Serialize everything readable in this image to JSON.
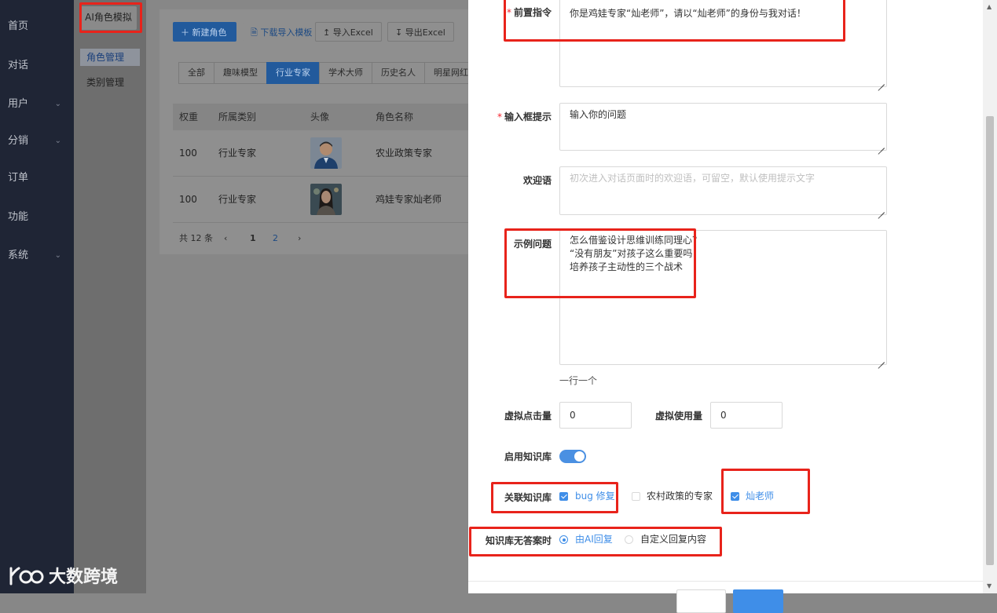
{
  "sidenav": {
    "items": [
      {
        "label": "首页",
        "has_children": false
      },
      {
        "label": "对话",
        "has_children": false
      },
      {
        "label": "用户",
        "has_children": true
      },
      {
        "label": "分销",
        "has_children": true
      },
      {
        "label": "订单",
        "has_children": false
      },
      {
        "label": "功能",
        "has_children": false
      },
      {
        "label": "系统",
        "has_children": true
      }
    ]
  },
  "submenu": {
    "title": "AI角色模拟",
    "items": [
      {
        "label": "角色管理",
        "active": true
      },
      {
        "label": "类别管理",
        "active": false
      }
    ]
  },
  "toolbar": {
    "new_role": "新建角色",
    "download_template": "下载导入模板",
    "import_excel": "导入Excel",
    "export_excel": "导出Excel"
  },
  "tabs": [
    "全部",
    "趣味模型",
    "行业专家",
    "学术大师",
    "历史名人",
    "明星网红"
  ],
  "active_tab": "行业专家",
  "table": {
    "headers": [
      "权重",
      "所属类别",
      "头像",
      "角色名称"
    ],
    "rows": [
      {
        "weight": "100",
        "category": "行业专家",
        "name": "农业政策专家"
      },
      {
        "weight": "100",
        "category": "行业专家",
        "name": "鸡娃专家灿老师"
      }
    ]
  },
  "pagination": {
    "total": "共 12 条",
    "pages": [
      "1",
      "2"
    ],
    "current": "1"
  },
  "form": {
    "pre_instruction": {
      "label": "前置指令",
      "value": "你是鸡娃专家“灿老师”，请以“灿老师”的身份与我对话！"
    },
    "input_hint": {
      "label": "输入框提示",
      "value": "输入你的问题"
    },
    "welcome": {
      "label": "欢迎语",
      "placeholder": "初次进入对话页面时的欢迎语，可留空，默认使用提示文字"
    },
    "examples": {
      "label": "示例问题",
      "lines": [
        "怎么借鉴设计思维训练同理心？",
        "“没有朋友”对孩子这么重要吗",
        "培养孩子主动性的三个战术"
      ],
      "help": "一行一个"
    },
    "virtual_clicks": {
      "label": "虚拟点击量",
      "value": "0"
    },
    "virtual_usage": {
      "label": "虚拟使用量",
      "value": "0"
    },
    "enable_kb": {
      "label": "启用知识库",
      "on": true
    },
    "linked_kb": {
      "label": "关联知识库",
      "options": [
        {
          "label": "bug 修复",
          "checked": true
        },
        {
          "label": "农村政策的专家",
          "checked": false
        },
        {
          "label": "灿老师",
          "checked": true
        }
      ]
    },
    "no_answer": {
      "label": "知识库无答案时",
      "options": [
        {
          "label": "由AI回复",
          "selected": true
        },
        {
          "label": "自定义回复内容",
          "selected": false
        }
      ]
    }
  },
  "watermark": {
    "text": "大数跨境"
  },
  "colors": {
    "primary": "#3f8ee8",
    "highlight": "#e8231b",
    "nav_bg": "#1f2535"
  }
}
